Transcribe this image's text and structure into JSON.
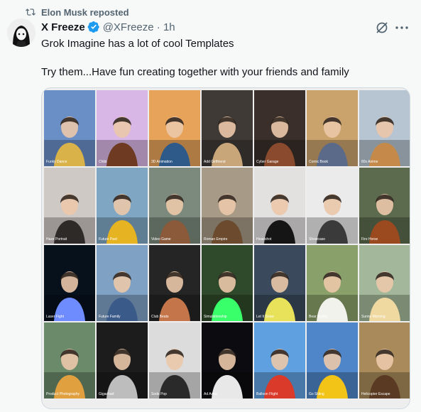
{
  "repost": {
    "icon": "repost-icon",
    "text": "Elon Musk reposted"
  },
  "author": {
    "name": "X Freeze",
    "handle": "@XFreeze · 1h",
    "verified_icon": "verified-badge-icon"
  },
  "post": {
    "line1": "Grok Imagine has a lot of cool Templates",
    "line2": "Try them...Have fun creating together with your friends and family"
  },
  "colors": {
    "verified": "#1d9bf0",
    "muted": "#536471",
    "text": "#0f1419",
    "background": "#f7f9f9"
  },
  "templates": [
    {
      "label": "Funky Dance",
      "bg": "#6a8fc7",
      "accent": "#d9b24a"
    },
    {
      "label": "Chibi",
      "bg": "#d8b7e6",
      "accent": "#6e3a22"
    },
    {
      "label": "3D Animation",
      "bg": "#e7a35a",
      "accent": "#2e5a8a"
    },
    {
      "label": "Add Girlfriend",
      "bg": "#3f3a36",
      "accent": "#c9a57a"
    },
    {
      "label": "Cyber Garage",
      "bg": "#3a2f2a",
      "accent": "#8a4a2e"
    },
    {
      "label": "Comic Book",
      "bg": "#c9a26c",
      "accent": "#5c6a8a"
    },
    {
      "label": "80s Anime",
      "bg": "#b7c4d1",
      "accent": "#c58a4a"
    },
    {
      "label": "Haze Portrait",
      "bg": "#cfc9c6",
      "accent": "#2e2a28"
    },
    {
      "label": "Future Past",
      "bg": "#7fa7c4",
      "accent": "#e6b422"
    },
    {
      "label": "Video Game",
      "bg": "#7b8a7c",
      "accent": "#8a5a3a"
    },
    {
      "label": "Roman Empire",
      "bg": "#a79a86",
      "accent": "#6b4a2e"
    },
    {
      "label": "Headshot",
      "bg": "#e3e1e0",
      "accent": "#151515"
    },
    {
      "label": "Showcase",
      "bg": "#ebebeb",
      "accent": "#3a3a3a"
    },
    {
      "label": "Fire Horse",
      "bg": "#5c6b4e",
      "accent": "#9a4a1e"
    },
    {
      "label": "Laser Fight",
      "bg": "#07111c",
      "accent": "#6f8cff"
    },
    {
      "label": "Future Family",
      "bg": "#7fa1c4",
      "accent": "#3a5a8a"
    },
    {
      "label": "Club Beats",
      "bg": "#252525",
      "accent": "#c4764a"
    },
    {
      "label": "Simulationship",
      "bg": "#2f4a2a",
      "accent": "#39ff6a"
    },
    {
      "label": "Let It Snow",
      "bg": "#3a4a5c",
      "accent": "#e8e25a"
    },
    {
      "label": "Bear Buddy",
      "bg": "#8aa06a",
      "accent": "#f2f2ec"
    },
    {
      "label": "Sunny Morning",
      "bg": "#a3b89a",
      "accent": "#f0d9a0"
    },
    {
      "label": "Product Photography",
      "bg": "#6a8a6a",
      "accent": "#e0a040"
    },
    {
      "label": "Gigachad",
      "bg": "#1c1c1c",
      "accent": "#bdbdbd"
    },
    {
      "label": "Soda Pop",
      "bg": "#dcdcdc",
      "accent": "#2a2a2a"
    },
    {
      "label": "Ad Astra",
      "bg": "#0c0c10",
      "accent": "#e8e8e8"
    },
    {
      "label": "Balloon Flight",
      "bg": "#5fa0e0",
      "accent": "#d93a2a"
    },
    {
      "label": "Go Skiing",
      "bg": "#4f86c9",
      "accent": "#f2c417"
    },
    {
      "label": "Helicopter Escape",
      "bg": "#a98a5a",
      "accent": "#5a3a22"
    }
  ]
}
